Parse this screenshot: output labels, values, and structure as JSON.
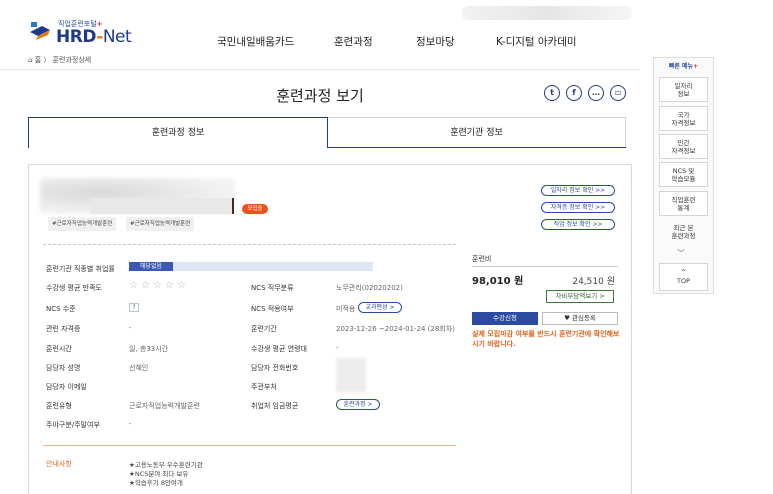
{
  "header": {
    "logo_sub": "직업훈련포털",
    "logo_sub_star": "+",
    "logo_hrd": "HRD",
    "logo_dash": "-",
    "logo_net": "Net",
    "nav": [
      "국민내일배움카드",
      "훈련과정",
      "정보마당",
      "K-디지털 아카데미"
    ]
  },
  "breadcrumb": {
    "home_icon": "home-icon",
    "home": "홈",
    "separator": "〉",
    "current": "훈련과정상세"
  },
  "page": {
    "title": "훈련과정 보기",
    "share_icons": [
      "twitter-icon",
      "facebook-icon",
      "chat-icon",
      "copy-icon"
    ]
  },
  "tabs": [
    {
      "label": "훈련과정 정보",
      "active": true
    },
    {
      "label": "훈련기관 정보",
      "active": false
    }
  ],
  "course": {
    "status_badge": "모집중",
    "tags": [
      "#근로자직업능력개발훈련",
      "#근로자직업능력개발훈련"
    ],
    "link_buttons": [
      "일자리 정보 확인 >>",
      "자격증 정보 확인 >>",
      "직업 정보 확인 >>"
    ],
    "info_left": [
      {
        "label": "훈련기관 직종별 취업률",
        "value": ""
      },
      {
        "label": "수강생 평균 만족도",
        "value": ""
      },
      {
        "label": "NCS 수준",
        "value": "?"
      },
      {
        "label": "관련 자격증",
        "value": "-"
      },
      {
        "label": "훈련시간",
        "value": "일, 총33시간"
      },
      {
        "label": "담당자 성명",
        "value": "선혜인"
      },
      {
        "label": "담당자 이메일",
        "value": ""
      },
      {
        "label": "훈련유형",
        "value": "근로자직업능력개발훈련"
      },
      {
        "label": "주야구분/주말여부",
        "value": "-"
      }
    ],
    "employment_rate_badge": "해당없음",
    "employment_rate_fill": 0.18,
    "satisfaction_stars": "☆☆☆☆☆",
    "info_right": [
      {
        "label": "NCS 직무분류",
        "value": "노무관리(02020202)"
      },
      {
        "label": "NCS 적용여부",
        "value": "미적용"
      },
      {
        "label": "훈련기간",
        "value": "2023-12-26 ~2024-01-24 (28회차)"
      },
      {
        "label": "수강생 평균 연령대",
        "value": "-"
      },
      {
        "label": "담당자 전화번호",
        "value": ""
      },
      {
        "label": "주관부처",
        "value": ""
      },
      {
        "label": "취업처 임금평균",
        "value": ""
      }
    ],
    "ncs_link": "교과편성 >",
    "wage_link": "훈련과정 >",
    "guide_label": "안내사항",
    "guide_items": [
      "★고용노동부 우수훈련기관",
      "★NCS분야 최다 보유",
      "★학습후기 8만여개"
    ]
  },
  "fee": {
    "label": "훈련비",
    "total": "98,010 원",
    "self_pay": "24,510 원",
    "self_pay_button": "자비부담액보기 >",
    "apply_button": "수강신청",
    "wish_icon": "heart-icon",
    "wish_button": "관심등록",
    "notice": "실제 모집마감 여부를 반드시 훈련기관에 확인해보시기 바랍니다."
  },
  "quick_menu": {
    "title": "빠른 메뉴",
    "title_star": "+",
    "items": [
      "일자리\n정보",
      "국가\n자격정보",
      "민간\n자격정보",
      "NCS 및\n학습모듈",
      "직업훈련\n통계",
      "최근 본\n훈련과정"
    ],
    "chevron_icon": "chevron-down-icon",
    "top_arrow": "^",
    "top_label": "TOP"
  },
  "colors": {
    "brand": "#1e3a8a",
    "accent": "#e8541e",
    "primary_button": "#2b4aa0"
  }
}
